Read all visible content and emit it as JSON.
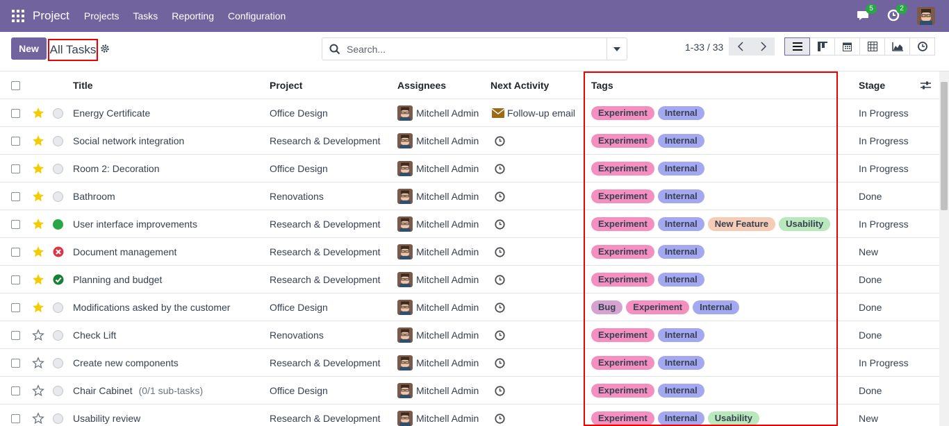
{
  "navbar": {
    "app_name": "Project",
    "menu": [
      "Projects",
      "Tasks",
      "Reporting",
      "Configuration"
    ],
    "messages_count": "5",
    "activities_count": "2"
  },
  "control_panel": {
    "new_label": "New",
    "breadcrumb": "All Tasks",
    "search_placeholder": "Search...",
    "pager": "1-33 / 33"
  },
  "table": {
    "columns": {
      "title": "Title",
      "project": "Project",
      "assignees": "Assignees",
      "next_activity": "Next Activity",
      "tags": "Tags",
      "stage": "Stage"
    },
    "rows": [
      {
        "starred": true,
        "status": "normal",
        "title": "Energy Certificate",
        "subtasks": "",
        "project": "Office Design",
        "assignee": "Mitchell Admin",
        "activity_icon": "envelope-icon",
        "activity_text": "Follow-up email",
        "tags": [
          "Experiment",
          "Internal"
        ],
        "stage": "In Progress"
      },
      {
        "starred": true,
        "status": "normal",
        "title": "Social network integration",
        "subtasks": "",
        "project": "Research & Development",
        "assignee": "Mitchell Admin",
        "activity_icon": "clock-icon",
        "activity_text": "",
        "tags": [
          "Experiment",
          "Internal"
        ],
        "stage": "In Progress"
      },
      {
        "starred": true,
        "status": "normal",
        "title": "Room 2: Decoration",
        "subtasks": "",
        "project": "Office Design",
        "assignee": "Mitchell Admin",
        "activity_icon": "clock-icon",
        "activity_text": "",
        "tags": [
          "Experiment",
          "Internal"
        ],
        "stage": "In Progress"
      },
      {
        "starred": true,
        "status": "normal",
        "title": "Bathroom",
        "subtasks": "",
        "project": "Renovations",
        "assignee": "Mitchell Admin",
        "activity_icon": "clock-icon",
        "activity_text": "",
        "tags": [
          "Experiment",
          "Internal"
        ],
        "stage": "Done"
      },
      {
        "starred": true,
        "status": "done",
        "title": "User interface improvements",
        "subtasks": "",
        "project": "Research & Development",
        "assignee": "Mitchell Admin",
        "activity_icon": "clock-icon",
        "activity_text": "",
        "tags": [
          "Experiment",
          "Internal",
          "New Feature",
          "Usability"
        ],
        "stage": "In Progress"
      },
      {
        "starred": true,
        "status": "blocked",
        "title": "Document management",
        "subtasks": "",
        "project": "Research & Development",
        "assignee": "Mitchell Admin",
        "activity_icon": "clock-icon",
        "activity_text": "",
        "tags": [
          "Experiment",
          "Internal"
        ],
        "stage": "New"
      },
      {
        "starred": true,
        "status": "approved",
        "title": "Planning and budget",
        "subtasks": "",
        "project": "Research & Development",
        "assignee": "Mitchell Admin",
        "activity_icon": "clock-icon",
        "activity_text": "",
        "tags": [
          "Experiment",
          "Internal"
        ],
        "stage": "Done"
      },
      {
        "starred": true,
        "status": "normal",
        "title": "Modifications asked by the customer",
        "subtasks": "",
        "project": "Office Design",
        "assignee": "Mitchell Admin",
        "activity_icon": "clock-icon",
        "activity_text": "",
        "tags": [
          "Bug",
          "Experiment",
          "Internal"
        ],
        "stage": "Done"
      },
      {
        "starred": false,
        "status": "normal",
        "title": "Check Lift",
        "subtasks": "",
        "project": "Renovations",
        "assignee": "Mitchell Admin",
        "activity_icon": "clock-icon",
        "activity_text": "",
        "tags": [
          "Experiment",
          "Internal"
        ],
        "stage": "Done"
      },
      {
        "starred": false,
        "status": "normal",
        "title": "Create new components",
        "subtasks": "",
        "project": "Research & Development",
        "assignee": "Mitchell Admin",
        "activity_icon": "clock-icon",
        "activity_text": "",
        "tags": [
          "Experiment",
          "Internal"
        ],
        "stage": "In Progress"
      },
      {
        "starred": false,
        "status": "normal",
        "title": "Chair Cabinet",
        "subtasks": "(0/1 sub-tasks)",
        "project": "Office Design",
        "assignee": "Mitchell Admin",
        "activity_icon": "clock-icon",
        "activity_text": "",
        "tags": [
          "Experiment",
          "Internal"
        ],
        "stage": "Done"
      },
      {
        "starred": false,
        "status": "normal",
        "title": "Usability review",
        "subtasks": "",
        "project": "Research & Development",
        "assignee": "Mitchell Admin",
        "activity_icon": "clock-icon",
        "activity_text": "",
        "tags": [
          "Experiment",
          "Internal",
          "Usability"
        ],
        "stage": "New"
      }
    ]
  },
  "colors": {
    "brand": "#71639e",
    "highlight": "#ee0000",
    "star": "#f3cc00",
    "tag_experiment": "#f48fc0",
    "tag_internal": "#a4a8f0",
    "tag_new_feature": "#f6ccb6",
    "tag_usability": "#b9e8bc",
    "tag_bug": "#d5a3cf"
  }
}
